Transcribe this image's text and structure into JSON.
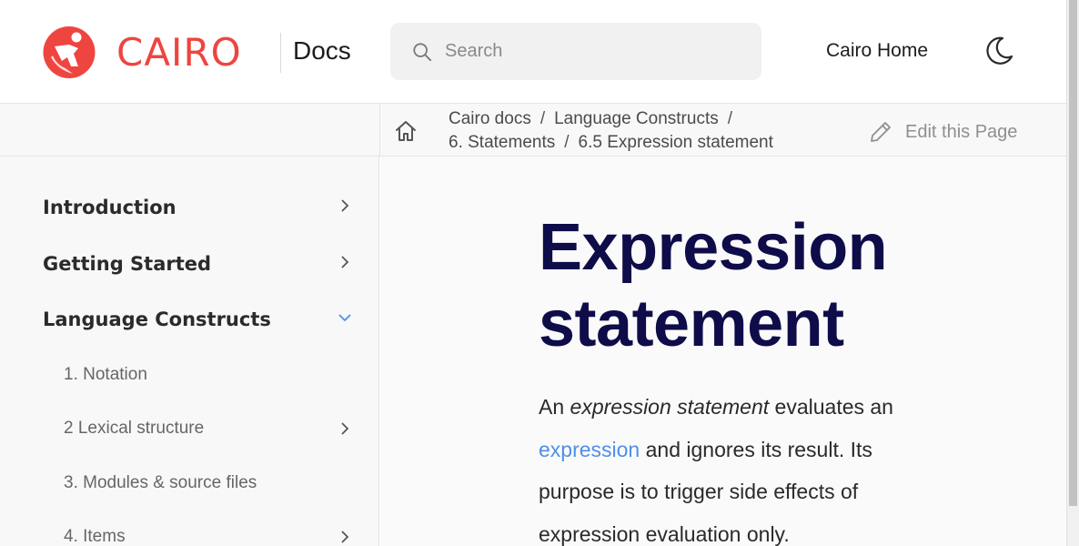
{
  "header": {
    "brand": "CAIRO",
    "docs_label": "Docs",
    "search_placeholder": "Search",
    "home_link": "Cairo Home",
    "brand_color": "#ee4540"
  },
  "breadcrumb": {
    "items": [
      "Cairo docs",
      "Language Constructs",
      "6. Statements",
      "6.5 Expression statement"
    ],
    "edit_label": "Edit this Page"
  },
  "sidebar": {
    "items": [
      {
        "label": "Introduction",
        "expanded": false
      },
      {
        "label": "Getting Started",
        "expanded": false
      },
      {
        "label": "Language Constructs",
        "expanded": true
      }
    ],
    "subitems": [
      {
        "label": "1. Notation",
        "has_children": false
      },
      {
        "label": "2 Lexical structure",
        "has_children": true
      },
      {
        "label": "3. Modules & source files",
        "has_children": false
      },
      {
        "label": "4. Items",
        "has_children": true
      }
    ]
  },
  "content": {
    "title_line1": "Expression",
    "title_line2": "statement",
    "para_prefix": "An ",
    "para_em": "expression statement",
    "para_mid": " evaluates an ",
    "para_link": "expression",
    "para_suffix": " and ignores its result. Its purpose is to trigger side effects of expression evaluation only.",
    "title_color": "#0f0c4a",
    "link_color": "#4f8fe6"
  }
}
